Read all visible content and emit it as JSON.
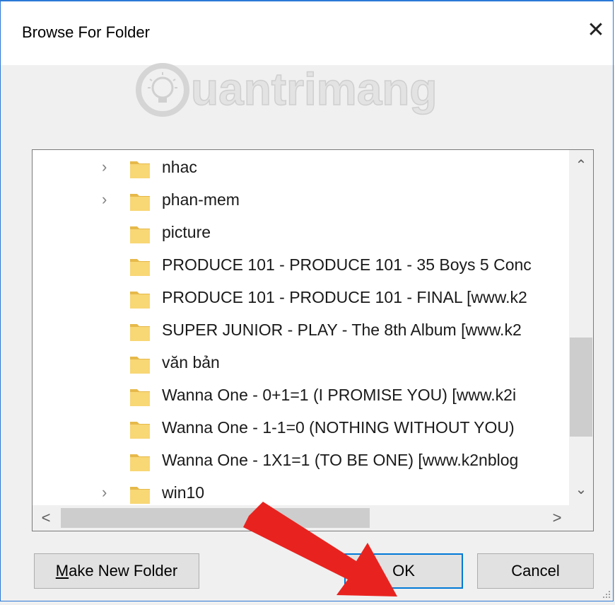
{
  "window": {
    "title": "Browse For Folder",
    "close_glyph": "✕"
  },
  "watermark": {
    "text": "uantrimang"
  },
  "tree": {
    "items": [
      {
        "label": "nhac",
        "expandable": true
      },
      {
        "label": "phan-mem",
        "expandable": true
      },
      {
        "label": "picture",
        "expandable": false
      },
      {
        "label": "PRODUCE 101 - PRODUCE 101 - 35 Boys 5 Conc",
        "expandable": false
      },
      {
        "label": "PRODUCE 101 - PRODUCE 101 - FINAL [www.k2",
        "expandable": false
      },
      {
        "label": "SUPER JUNIOR - PLAY - The 8th Album [www.k2",
        "expandable": false
      },
      {
        "label": "văn bản",
        "expandable": false
      },
      {
        "label": "Wanna One - 0+1=1 (I PROMISE YOU) [www.k2i",
        "expandable": false
      },
      {
        "label": "Wanna One - 1-1=0 (NOTHING WITHOUT YOU)",
        "expandable": false
      },
      {
        "label": "Wanna One - 1X1=1 (TO BE ONE) [www.k2nblog",
        "expandable": false
      },
      {
        "label": "win10",
        "expandable": true
      }
    ],
    "chevron_glyph": "›",
    "scroll_up_glyph": "⌃",
    "scroll_down_glyph": "⌄",
    "scroll_left_glyph": "<",
    "scroll_right_glyph": ">"
  },
  "buttons": {
    "make_new_folder_prefix": "M",
    "make_new_folder_rest": "ake New Folder",
    "ok": "OK",
    "cancel": "Cancel"
  },
  "colors": {
    "accent": "#0078d7",
    "folder": "#f8d775",
    "arrow": "#e8231f"
  }
}
